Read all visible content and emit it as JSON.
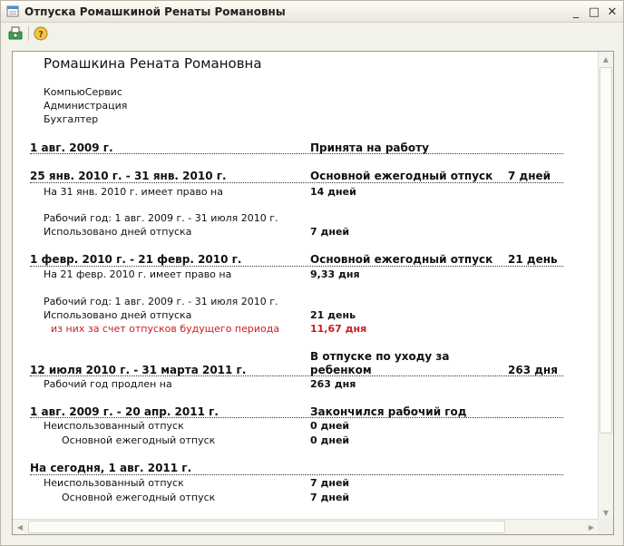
{
  "window": {
    "title": "Отпуска Ромашкиной Ренаты Романовны",
    "minimize_symbol": "_",
    "maximize_symbol": "□",
    "close_symbol": "✕"
  },
  "toolbar": {
    "help_symbol": "?"
  },
  "report": {
    "employee_name": "Ромашкина Рената Романовна",
    "org": "КомпьюСервис",
    "department": "Администрация",
    "position": "Бухгалтер",
    "rows": [
      {
        "date": "1 авг. 2009 г.",
        "event": "Принята на работу"
      },
      {
        "date": "25 янв. 2010 г. - 31 янв. 2010 г.",
        "event": "Основной ежегодный отпуск",
        "duration": "7 дней",
        "entitled_label": "На 31 янв. 2010 г. имеет право на",
        "entitled_value": "14 дней",
        "work_year": "Рабочий год: 1 авг. 2009 г. - 31 июля 2010 г.",
        "used_label": "Использовано дней отпуска",
        "used_value": "7 дней"
      },
      {
        "date": "1 февр. 2010 г. - 21 февр. 2010 г.",
        "event": "Основной ежегодный отпуск",
        "duration": "21 день",
        "entitled_label": "На 21 февр. 2010 г. имеет право на",
        "entitled_value": "9,33 дня",
        "work_year": "Рабочий год: 1 авг. 2009 г. - 31 июля 2010 г.",
        "used_label": "Использовано дней отпуска",
        "used_value": "21 день",
        "future_label": "из них за счет отпусков будущего периода",
        "future_value": "11,67 дня"
      },
      {
        "date": "12 июля 2010 г. - 31 марта 2011 г.",
        "event_line1": "В отпуске по уходу за",
        "event_line2": "ребенком",
        "duration": "263 дня",
        "extended_label": "Рабочий год продлен на",
        "extended_value": "263 дня"
      },
      {
        "date": "1 авг. 2009 г. - 20 апр. 2011 г.",
        "event": "Закончился рабочий год",
        "unused_label": "Неиспользованный отпуск",
        "unused_value": "0 дней",
        "main_label": "Основной ежегодный отпуск",
        "main_value": "0 дней"
      },
      {
        "date": "На сегодня, 1 авг. 2011 г.",
        "unused_label": "Неиспользованный отпуск",
        "unused_value": "7 дней",
        "main_label": "Основной ежегодный отпуск",
        "main_value": "7 дней"
      }
    ]
  }
}
